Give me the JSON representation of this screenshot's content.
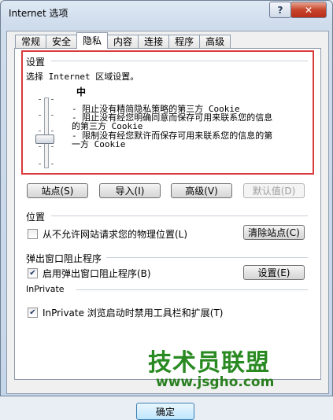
{
  "window": {
    "title": "Internet 选项",
    "help_label": "?",
    "close_label": "✕"
  },
  "tabs": [
    {
      "label": "常规",
      "active": false
    },
    {
      "label": "安全",
      "active": false
    },
    {
      "label": "隐私",
      "active": true
    },
    {
      "label": "内容",
      "active": false
    },
    {
      "label": "连接",
      "active": false
    },
    {
      "label": "程序",
      "active": false
    },
    {
      "label": "高级",
      "active": false
    }
  ],
  "settings": {
    "heading": "设置",
    "instruction": "选择 Internet 区域设置。",
    "level": "中",
    "bullets": [
      "- 阻止没有精简隐私策略的第三方 Cookie",
      "- 阻止没有经您明确同意而保存可用来联系您的信息",
      "  的第三方 Cookie",
      "- 限制没有经您默许而保存可用来联系您的信息的第",
      "  一方 Cookie"
    ],
    "slider_level_fraction": 0.5,
    "buttons": {
      "sites": "站点(S)",
      "import": "导入(I)",
      "advanced": "高级(V)",
      "default": "默认值(D)"
    }
  },
  "location": {
    "heading": "位置",
    "checkbox_label": "从不允许网站请求您的物理位置(L)",
    "checked": false,
    "clear_button": "清除站点(C)"
  },
  "popup": {
    "heading": "弹出窗口阻止程序",
    "checkbox_label": "启用弹出窗口阻止程序(B)",
    "checked": true,
    "settings_button": "设置(E)"
  },
  "inprivate": {
    "heading": "InPrivate",
    "checkbox_label": "InPrivate 浏览启动时禁用工具栏和扩展(T)",
    "checked": true
  },
  "bottom": {
    "ok_label": "确定"
  },
  "watermark": {
    "text": "技术员联盟",
    "url": "www.jsgho.com"
  }
}
